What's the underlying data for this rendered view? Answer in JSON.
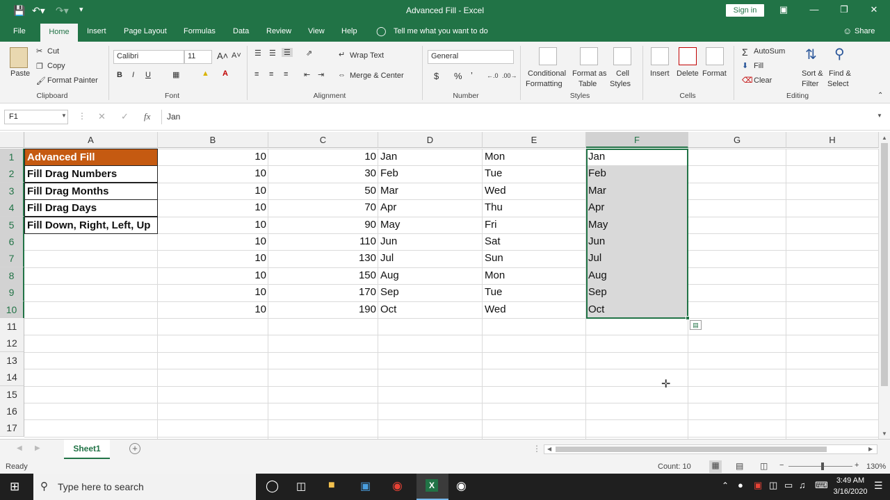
{
  "window": {
    "title": "Advanced Fill  -  Excel",
    "signin": "Sign in"
  },
  "tabs": [
    "File",
    "Home",
    "Insert",
    "Page Layout",
    "Formulas",
    "Data",
    "Review",
    "View",
    "Help"
  ],
  "tell_me": "Tell me what you want to do",
  "share": "Share",
  "ribbon": {
    "clipboard": {
      "paste": "Paste",
      "cut": "Cut",
      "copy": "Copy",
      "format_painter": "Format Painter",
      "label": "Clipboard"
    },
    "font": {
      "family": "Calibri",
      "size": "11",
      "bold": "B",
      "italic": "I",
      "underline": "U",
      "label": "Font"
    },
    "alignment": {
      "wrap_text": "Wrap Text",
      "merge_center": "Merge & Center",
      "label": "Alignment"
    },
    "number": {
      "format": "General",
      "currency": "$",
      "percent": "%",
      "comma": "’",
      "label": "Number"
    },
    "styles": {
      "conditional_1": "Conditional",
      "conditional_2": "Formatting",
      "format_table_1": "Format as",
      "format_table_2": "Table",
      "cell_styles_1": "Cell",
      "cell_styles_2": "Styles",
      "label": "Styles"
    },
    "cells": {
      "insert": "Insert",
      "delete": "Delete",
      "format": "Format",
      "label": "Cells"
    },
    "editing": {
      "autosum": "AutoSum",
      "fill": "Fill",
      "clear": "Clear",
      "sort_1": "Sort &",
      "sort_2": "Filter",
      "find_1": "Find &",
      "find_2": "Select",
      "label": "Editing"
    }
  },
  "formula_bar": {
    "name_box": "F1",
    "fx": "fx",
    "value": "Jan"
  },
  "columns": [
    "A",
    "B",
    "C",
    "D",
    "E",
    "F",
    "G",
    "H"
  ],
  "rows": [
    "1",
    "2",
    "3",
    "4",
    "5",
    "6",
    "7",
    "8",
    "9",
    "10",
    "11",
    "12",
    "13",
    "14",
    "15",
    "16",
    "17"
  ],
  "column_a": [
    "Advanced Fill",
    "Fill Drag Numbers",
    "Fill Drag Months",
    "Fill Drag Days",
    "Fill Down, Right, Left, Up"
  ],
  "column_b": [
    "10",
    "10",
    "10",
    "10",
    "10",
    "10",
    "10",
    "10",
    "10",
    "10"
  ],
  "column_c": [
    "10",
    "30",
    "50",
    "70",
    "90",
    "110",
    "130",
    "150",
    "170",
    "190"
  ],
  "column_d": [
    "Jan",
    "Feb",
    "Mar",
    "Apr",
    "May",
    "Jun",
    "Jul",
    "Aug",
    "Sep",
    "Oct"
  ],
  "column_e": [
    "Mon",
    "Tue",
    "Wed",
    "Thu",
    "Fri",
    "Sat",
    "Sun",
    "Mon",
    "Tue",
    "Wed"
  ],
  "column_f": [
    "Jan",
    "Feb",
    "Mar",
    "Apr",
    "May",
    "Jun",
    "Jul",
    "Aug",
    "Sep",
    "Oct"
  ],
  "colors": {
    "accent": "#217346",
    "title_fill": "#c55a11",
    "selection": "#d9d9d9"
  },
  "sheets": {
    "active": "Sheet1"
  },
  "status": {
    "mode": "Ready",
    "count": "Count: 10",
    "zoom": "130%"
  },
  "taskbar": {
    "search_placeholder": "Type here to search",
    "time": "3:49 AM",
    "date": "3/16/2020"
  }
}
